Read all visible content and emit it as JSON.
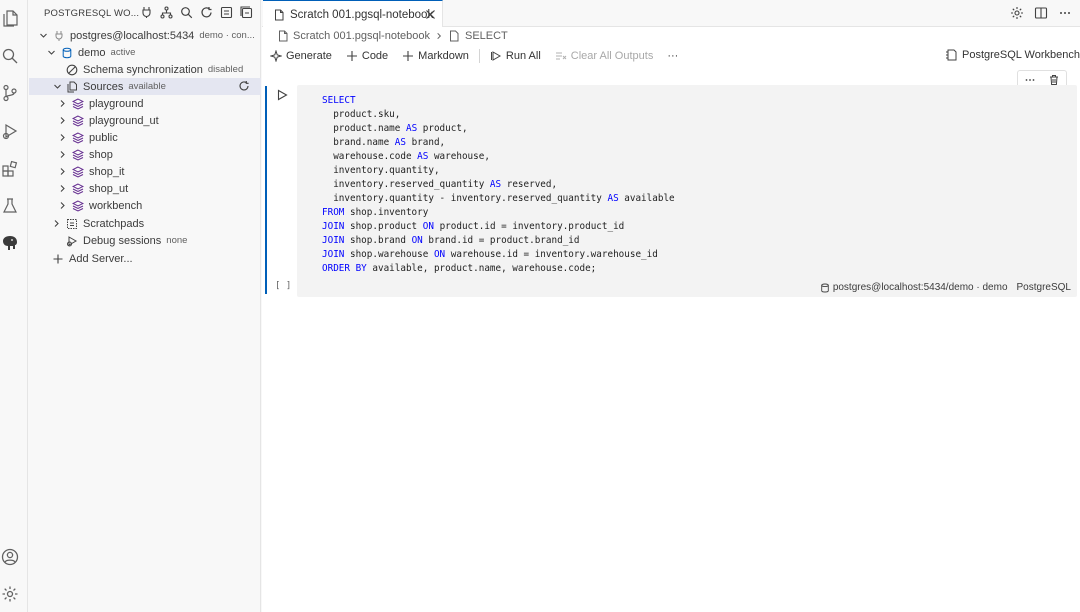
{
  "sidebar": {
    "title": "POSTGRESQL WO...",
    "connection": {
      "label": "postgres@localhost:5434",
      "desc": "demo · con..."
    },
    "database": {
      "label": "demo",
      "desc": "active"
    },
    "schema_sync": {
      "label": "Schema synchronization",
      "desc": "disabled"
    },
    "sources": {
      "label": "Sources",
      "desc": "available"
    },
    "schemas": [
      "playground",
      "playground_ut",
      "public",
      "shop",
      "shop_it",
      "shop_ut",
      "workbench"
    ],
    "scratchpads": {
      "label": "Scratchpads"
    },
    "debug_sessions": {
      "label": "Debug sessions",
      "desc": "none"
    },
    "add_server": {
      "label": "Add Server..."
    }
  },
  "editor": {
    "tab_label": "Scratch 001.pgsql-notebook",
    "breadcrumb": {
      "file": "Scratch 001.pgsql-notebook",
      "symbol": "SELECT"
    },
    "toolbar": {
      "generate": "Generate",
      "code": "Code",
      "markdown": "Markdown",
      "run_all": "Run All",
      "clear_outputs": "Clear All Outputs",
      "more": "···",
      "kernel": "PostgreSQL Workbench"
    },
    "cell": {
      "exec_count": "[ ]",
      "status_connection": "postgres@localhost:5434/demo · demo",
      "status_language": "PostgreSQL",
      "more": "···"
    }
  }
}
